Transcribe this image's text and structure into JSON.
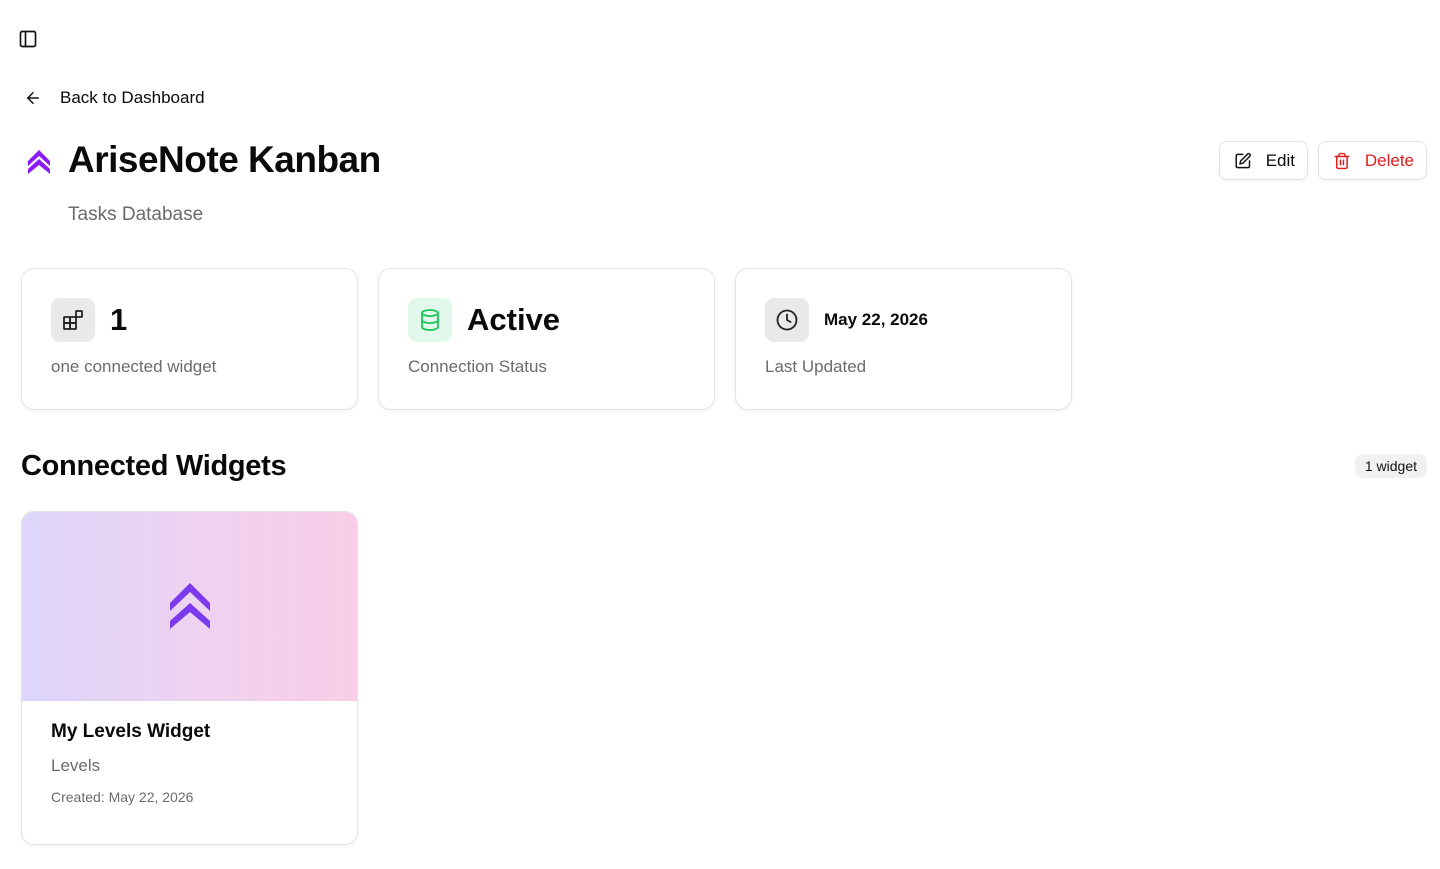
{
  "header": {
    "sidebar_toggle_icon": "sidebar-panel-icon",
    "back_label": "Back to Dashboard",
    "back_icon": "arrow-left-icon"
  },
  "database": {
    "title": "AriseNote Kanban",
    "subtitle": "Tasks Database",
    "logo_icon": "double-chevron-up-icon",
    "logo_color": "#8b1cf5"
  },
  "actions": {
    "edit_label": "Edit",
    "edit_icon": "pencil-square-icon",
    "delete_label": "Delete",
    "delete_icon": "trash-icon",
    "delete_color": "#e11d1d"
  },
  "stats": [
    {
      "icon": "widgets-icon",
      "value": "1",
      "label": "one connected widget"
    },
    {
      "icon": "database-icon",
      "value": "Active",
      "label": "Connection Status",
      "icon_color": "#22c55e"
    },
    {
      "icon": "clock-icon",
      "value": "May 22, 2026",
      "label": "Last Updated"
    }
  ],
  "widgets_section": {
    "title": "Connected Widgets",
    "count_label": "1 widget",
    "items": [
      {
        "name": "My Levels Widget",
        "type": "Levels",
        "created": "Created: May 22, 2026",
        "preview_icon": "double-chevron-up-icon",
        "preview_icon_color": "#7c3aed"
      }
    ]
  }
}
